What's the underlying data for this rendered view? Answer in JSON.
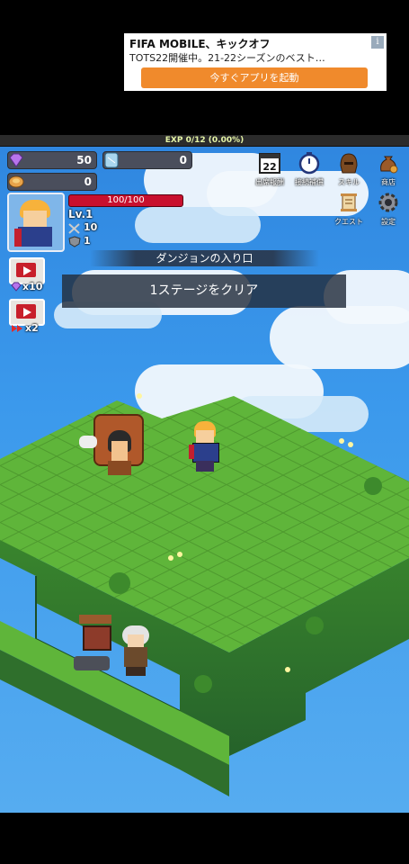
{
  "ad": {
    "title": "FIFA MOBILE、キックオフ",
    "body": "TOTS22開催中。21-22シーズンのベスト…",
    "cta": "今すぐアプリを起動",
    "info_icon": "i"
  },
  "hud": {
    "exp_text": "EXP 0/12 (0.00%)",
    "exp_progress": 0,
    "gems": "50",
    "crystals": "0",
    "coins": "0"
  },
  "menu": [
    {
      "label": "出席報酬",
      "icon": "calendar-icon",
      "badge": "22"
    },
    {
      "label": "接続補償",
      "icon": "stopwatch-icon"
    },
    {
      "label": "スキル",
      "icon": "helmet-icon"
    },
    {
      "label": "商店",
      "icon": "money-bag-icon"
    },
    {
      "label": "クエスト",
      "icon": "scroll-icon"
    },
    {
      "label": "設定",
      "icon": "gear-icon"
    }
  ],
  "player": {
    "hp_text": "100/100",
    "hp_fraction": 1.0,
    "level": "Lv.1",
    "attack": "10",
    "defense": "1"
  },
  "stage": {
    "name": "ダンジョンの入り口",
    "banner": "1ステージをクリア"
  },
  "boosts": [
    {
      "label": "x10",
      "icon": "gem-icon"
    },
    {
      "label": "x2",
      "icon": "fast-forward-icon"
    }
  ],
  "colors": {
    "hp_bar": "#c8102e",
    "ad_button": "#f08a2c",
    "grass_top": "#5fb53a",
    "sky": "#3b99ec"
  }
}
